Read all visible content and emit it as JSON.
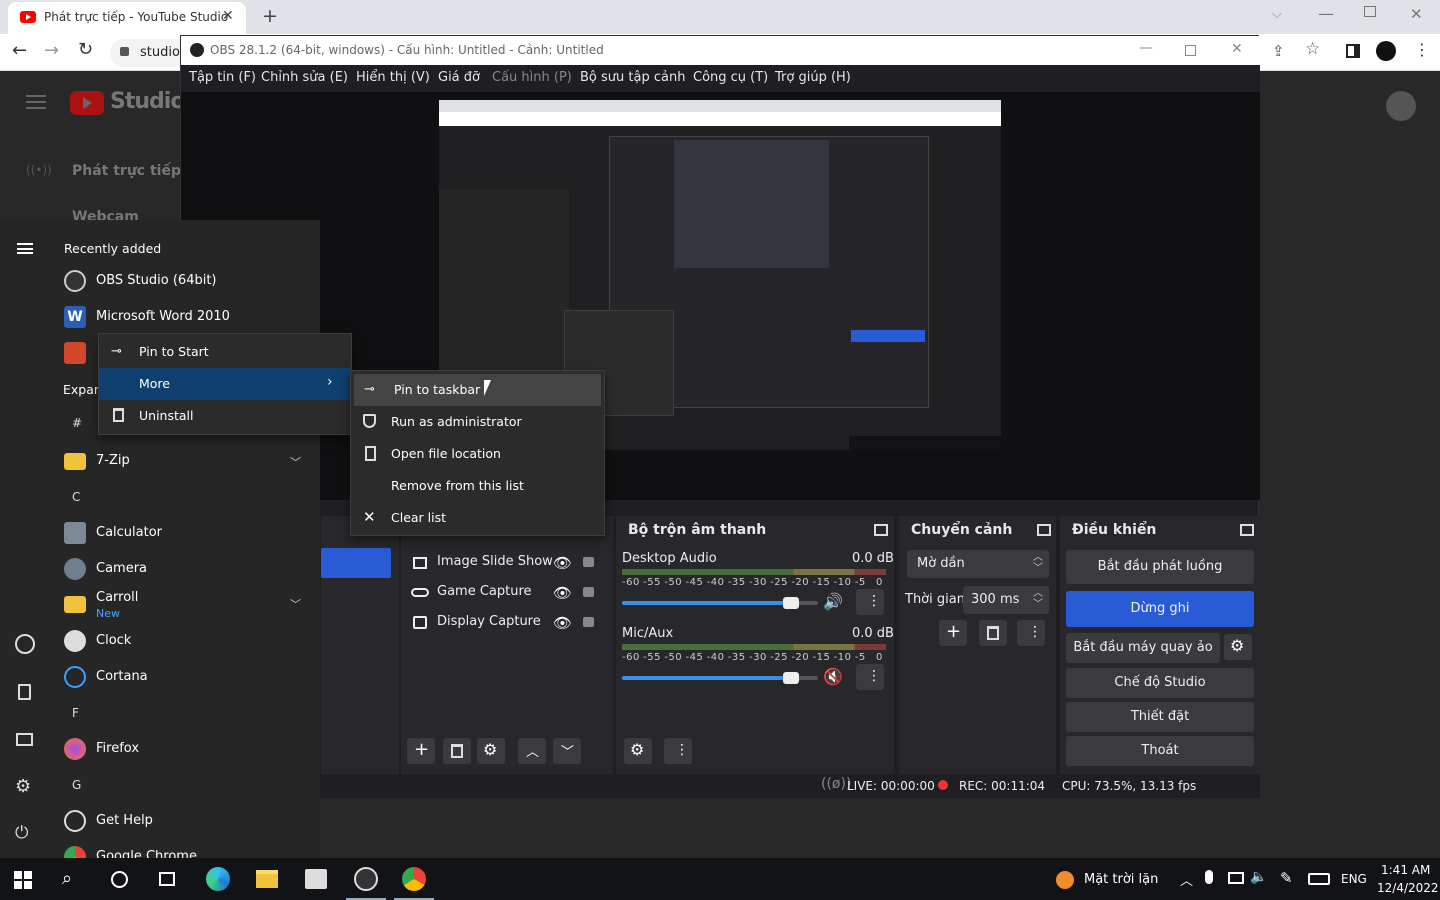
{
  "chrome": {
    "tab_title": "Phát trực tiếp - YouTube Studio",
    "address_partial": "studio"
  },
  "youtube": {
    "logo_text": "Studio",
    "nav_live": "Phát trực tiếp",
    "nav_webcam": "Webcam"
  },
  "obs": {
    "title": "OBS 28.1.2 (64-bit, windows) - Cấu hình: Untitled - Cảnh: Untitled",
    "menu": [
      "Tập tin (F)",
      "Chỉnh sửa (E)",
      "Hiển thị (V)",
      "Giá đỡ",
      "Cấu hình (P)",
      "Bộ sưu tập cảnh",
      "Công cụ (T)",
      "Trợ giúp (H)"
    ],
    "sources": [
      {
        "label": "Image Slide Show",
        "icon": "slideshow-icon"
      },
      {
        "label": "Game Capture",
        "icon": "gamepad-icon"
      },
      {
        "label": "Display Capture",
        "icon": "monitor-icon"
      }
    ],
    "mixer": {
      "title": "Bộ trộn âm thanh",
      "channels": [
        {
          "name": "Desktop Audio",
          "db": "0.0 dB",
          "level": 0.82,
          "muted": false
        },
        {
          "name": "Mic/Aux",
          "db": "0.0 dB",
          "level": 0.82,
          "muted": true
        }
      ],
      "scale": [
        "-60",
        "-55",
        "-50",
        "-45",
        "-40",
        "-35",
        "-30",
        "-25",
        "-20",
        "-15",
        "-10",
        "-5",
        "0"
      ]
    },
    "transitions": {
      "title": "Chuyển cảnh",
      "selected": "Mờ dần",
      "duration_label": "Thời gian",
      "duration_value": "300 ms"
    },
    "controls": {
      "title": "Điều khiển",
      "start_stream": "Bắt đầu phát luồng",
      "stop_record": "Dừng ghi",
      "virtual_cam": "Bắt đầu máy quay ảo",
      "studio_mode": "Chế độ Studio",
      "settings": "Thiết đặt",
      "exit": "Thoát"
    },
    "status": {
      "live": "LIVE: 00:00:00",
      "rec": "REC: 00:11:04",
      "cpu": "CPU: 73.5%, 13.13 fps"
    }
  },
  "start_menu": {
    "recently_added": "Recently added",
    "expand_partial": "Expan",
    "recent": [
      {
        "label": "OBS Studio (64bit)"
      },
      {
        "label": "Microsoft Word 2010"
      }
    ],
    "apps": {
      "hash": "#",
      "zip": "7-Zip",
      "c": "C",
      "calculator": "Calculator",
      "camera": "Camera",
      "carroll": "Carroll",
      "carroll_new": "New",
      "clock": "Clock",
      "cortana": "Cortana",
      "f": "F",
      "firefox": "Firefox",
      "g": "G",
      "get_help": "Get Help",
      "chrome": "Google Chrome"
    }
  },
  "context_menu": {
    "pin_start": "Pin to Start",
    "more": "More",
    "uninstall": "Uninstall"
  },
  "submenu": {
    "pin_taskbar": "Pin to taskbar",
    "run_admin": "Run as administrator",
    "open_location": "Open file location",
    "remove_list": "Remove from this list",
    "clear_list": "Clear list"
  },
  "taskbar": {
    "weather": "Mặt trời lặn",
    "lang": "ENG",
    "time": "1:41 AM",
    "date": "12/4/2022"
  },
  "colors": {
    "obs_blue": "#2a5bd7",
    "ctx_highlight": "#0f3f6e",
    "rec_red": "#e33"
  }
}
